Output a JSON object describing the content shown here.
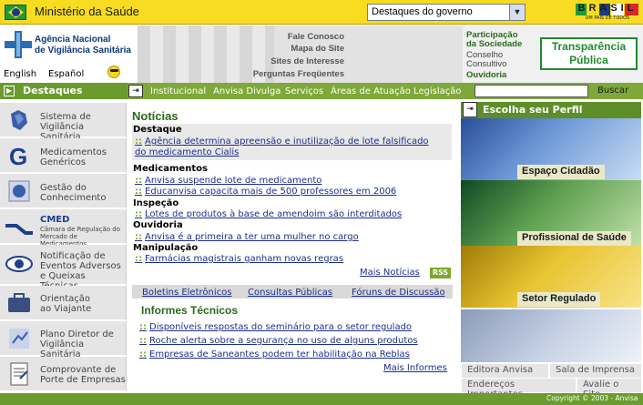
{
  "topbar": {
    "ministry": "Ministério da Saúde",
    "select_value": "Destaques do governo",
    "brasil_text": "BRASIL",
    "brasil_tagline": "UM PAÍS DE TODOS"
  },
  "header": {
    "agency_line1": "Agência Nacional",
    "agency_line2": "de Vigilância Sanitária",
    "lang_en": "English",
    "lang_es": "Español",
    "links": [
      "Fale Conosco",
      "Mapa do Site",
      "Sites de Interesse",
      "Perguntas Freqüentes"
    ],
    "participacao": [
      "Participação",
      "da Sociedade",
      "Conselho",
      "Consultivo",
      "Ouvidoria"
    ],
    "transparencia_1": "Transparência",
    "transparencia_2": "Pública"
  },
  "nav": {
    "destaques": "Destaques",
    "items": [
      "Institucional",
      "Anvisa Divulga",
      "Serviços",
      "Áreas de Atuação",
      "Legislação"
    ],
    "search_button": "Buscar"
  },
  "sidebar": [
    {
      "l1": "Sistema  de",
      "l2": "Vigilância Sanitária",
      "l3": "",
      "icon": "map-icon"
    },
    {
      "l1": "Medicamentos",
      "l2": "Genéricos",
      "l3": "",
      "icon": "generic-g-icon"
    },
    {
      "l1": "Gestão do",
      "l2": "Conhecimento",
      "l3": "",
      "icon": "knowledge-icon"
    },
    {
      "l1": "CMED",
      "l2": "Câmara de Regulação do",
      "l3": "Mercado de Medicamentos",
      "icon": "cmed-icon"
    },
    {
      "l1": "Notificação de",
      "l2": "Eventos Adversos",
      "l3": "e Queixas Técnicas",
      "icon": "eye-icon"
    },
    {
      "l1": "Orientação",
      "l2": "ao Viajante",
      "l3": "",
      "icon": "suitcase-icon"
    },
    {
      "l1": "Plano Diretor de",
      "l2": "Vigilância Sanitária",
      "l3": "",
      "icon": "plan-icon"
    },
    {
      "l1": "Comprovante de",
      "l2": "Porte de Empresas",
      "l3": "",
      "icon": "document-icon"
    }
  ],
  "noticias": {
    "title": "Notícias",
    "destaque": "Destaque",
    "destaque_link1": "Agência determina apreensão e inutilização de lote falsificado",
    "destaque_link2": "do medicamento Cialis",
    "medicamentos": "Medicamentos",
    "med_links": [
      "Anvisa suspende lote de medicamento",
      "Educanvisa capacita mais de 500 professores em 2006"
    ],
    "inspecao": "Inspeção",
    "insp_link": "Lotes de produtos à base de amendoim são interditados",
    "ouvidoria": "Ouvidoria",
    "ouv_link": "Anvisa é a primeira a ter uma mulher no cargo",
    "manipulacao": "Manipulação",
    "manip_link": "Farmácias magistrais ganham novas regras",
    "mais": "Mais Notícias",
    "rss": "RSS"
  },
  "tabs": [
    "Boletins Eletrônicos",
    "Consultas Públicas",
    "Fóruns de Discussão"
  ],
  "informes": {
    "title": "Informes Técnicos",
    "links": [
      "Disponíveis respostas do seminário para o setor regulado",
      "Roche alerta sobre a segurança no uso de alguns produtos",
      "Empresas de Saneantes podem ter habilitação na Reblas"
    ],
    "mais": "Mais Informes"
  },
  "perfil": {
    "title": "Escolha seu Perfil",
    "items": [
      "Espaço Cidadão",
      "Profissional de Saúde",
      "Setor Regulado"
    ]
  },
  "bottom_links": [
    "Editora Anvisa",
    "Sala de Imprensa",
    "Endereços Importantes",
    "Avalie o Site"
  ],
  "footer": {
    "copyright": "Copyright © 2003 - Anvisa"
  },
  "colors": {
    "yellow": "#f7dc21",
    "green": "#7fa83a",
    "dark_green": "#2a6a1a",
    "link_blue": "#1c2f8a"
  }
}
